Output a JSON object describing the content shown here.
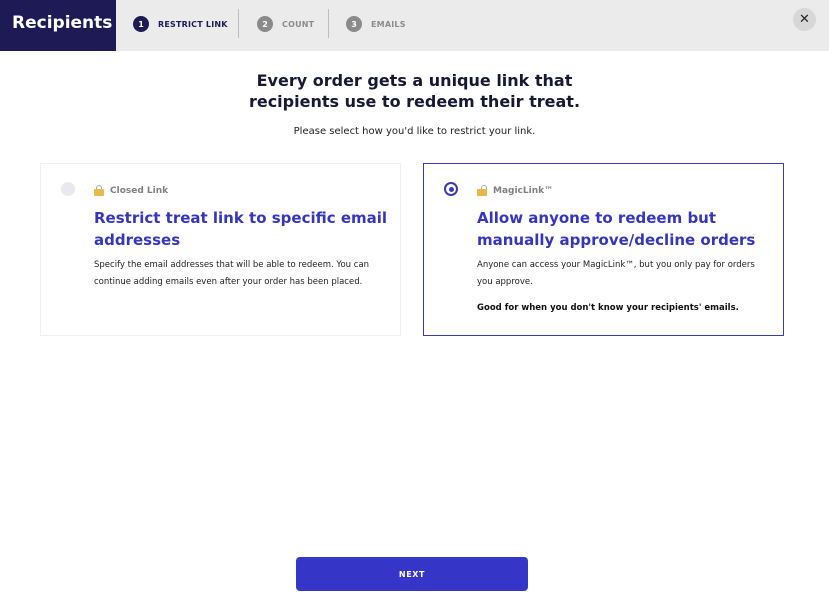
{
  "header": {
    "title": "Recipients",
    "steps": [
      {
        "number": "1",
        "label": "RESTRICT LINK"
      },
      {
        "number": "2",
        "label": "COUNT"
      },
      {
        "number": "3",
        "label": "EMAILS"
      }
    ],
    "close_icon": "close-icon"
  },
  "main": {
    "headline_line1": "Every order gets a unique link that",
    "headline_line2": "recipients use to redeem their treat.",
    "subhead": "Please select how you'd like to restrict your link."
  },
  "options": [
    {
      "tag": "Closed Link",
      "title": "Restrict treat link to specific email addresses",
      "description": "Specify the email addresses that will be able to redeem. You can continue adding emails even after your order has been placed.",
      "selected": false
    },
    {
      "tag": "MagicLink™",
      "title": "Allow anyone to redeem but manually approve/decline orders",
      "description": "Anyone can access your MagicLink™, but you only pay for orders you approve.",
      "note": "Good for when you don't know your recipients' emails.",
      "selected": true
    }
  ],
  "footer": {
    "next_label": "NEXT"
  },
  "colors": {
    "brand": "#1d1a55",
    "accent": "#3535c8"
  }
}
